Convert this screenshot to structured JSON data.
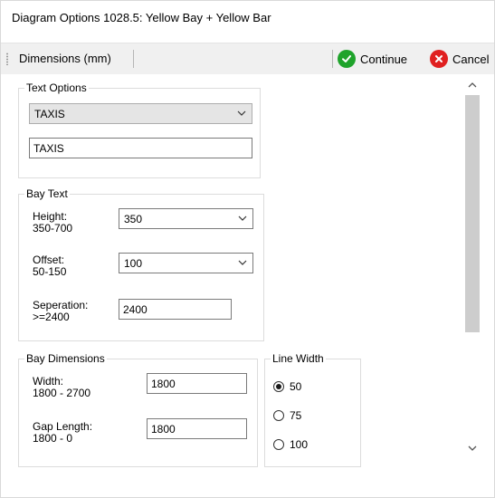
{
  "window": {
    "title": "Diagram Options 1028.5: Yellow Bay + Yellow Bar"
  },
  "toolbar": {
    "dimensions_label": "Dimensions (mm)",
    "continue_label": "Continue",
    "cancel_label": "Cancel",
    "continue_icon": "check-circle-icon",
    "cancel_icon": "x-circle-icon",
    "continue_color": "#1fa32b",
    "cancel_color": "#e02020"
  },
  "text_options": {
    "title": "Text Options",
    "combo_value": "TAXIS",
    "text_value": "TAXIS"
  },
  "bay_text": {
    "title": "Bay Text",
    "height_label": "Height:\n350-700",
    "height_value": "350",
    "offset_label": "Offset:\n50-150",
    "offset_value": "100",
    "separation_label": "Seperation:\n>=2400",
    "separation_value": "2400"
  },
  "bay_dimensions": {
    "title": "Bay Dimensions",
    "width_label": "Width:\n1800 - 2700",
    "width_value": "1800",
    "gap_label": "Gap Length:\n1800 - 0",
    "gap_value": "1800"
  },
  "line_width": {
    "title": "Line Width",
    "options": [
      "50",
      "75",
      "100"
    ],
    "selected": "50"
  }
}
